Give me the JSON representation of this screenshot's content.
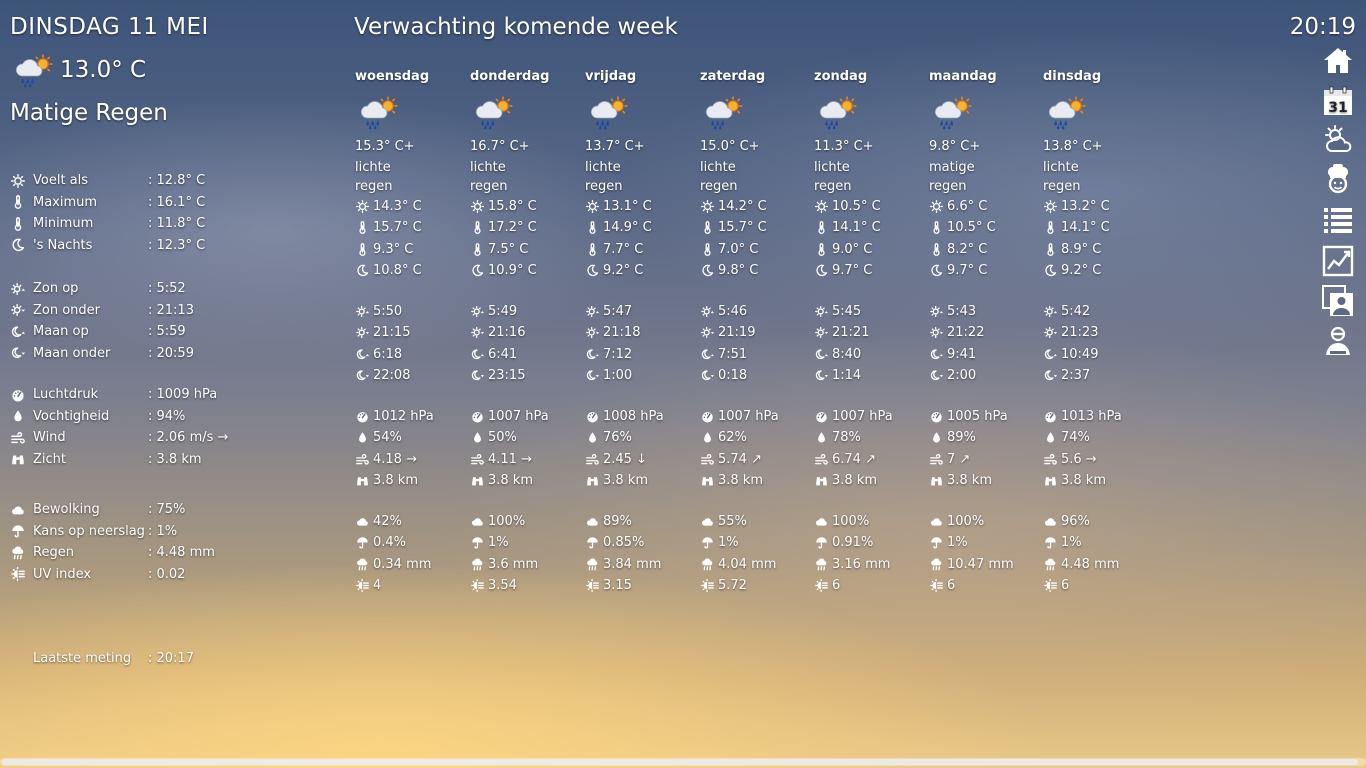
{
  "header": {
    "date": "DINSDAG 11 MEI",
    "clock": "20:19",
    "forecast_title": "Verwachting komende week"
  },
  "current": {
    "temperature": "13.0° C",
    "condition": "Matige Regen",
    "icon": "rain-sun-icon",
    "stats": [
      {
        "icon": "sun-icon",
        "label": "Voelt als",
        "value": ": 12.8° C"
      },
      {
        "icon": "thermometer-icon",
        "label": "Maximum",
        "value": ": 16.1° C"
      },
      {
        "icon": "thermometer-icon",
        "label": "Minimum",
        "value": ": 11.8° C"
      },
      {
        "icon": "moon-icon",
        "label": "'s Nachts",
        "value": ": 12.3° C"
      }
    ],
    "sun_moon": [
      {
        "icon": "sunrise-icon",
        "label": "Zon op",
        "value": ": 5:52"
      },
      {
        "icon": "sunset-icon",
        "label": "Zon onder",
        "value": ": 21:13"
      },
      {
        "icon": "moonrise-icon",
        "label": "Maan op",
        "value": ": 5:59"
      },
      {
        "icon": "moonset-icon",
        "label": "Maan onder",
        "value": ": 20:59"
      }
    ],
    "atmosphere": [
      {
        "icon": "gauge-icon",
        "label": "Luchtdruk",
        "value": ": 1009 hPa"
      },
      {
        "icon": "droplet-icon",
        "label": "Vochtigheid",
        "value": ": 94%"
      },
      {
        "icon": "wind-icon",
        "label": "Wind",
        "value": ": 2.06 m/s →"
      },
      {
        "icon": "binoculars-icon",
        "label": "Zicht",
        "value": ": 3.8 km"
      }
    ],
    "precip": [
      {
        "icon": "cloud-icon",
        "label": "Bewolking",
        "value": ": 75%"
      },
      {
        "icon": "umbrella-icon",
        "label": "Kans op neerslag",
        "value": ": 1%"
      },
      {
        "icon": "rain-icon",
        "label": "Regen",
        "value": ": 4.48 mm"
      },
      {
        "icon": "uv-icon",
        "label": "UV index",
        "value": ": 0.02"
      }
    ],
    "last_measure": {
      "label": "Laatste meting",
      "value": ": 20:17"
    }
  },
  "forecast": [
    {
      "day": "woensdag",
      "temp": "15.3° C+",
      "cond": "lichte regen",
      "feels": "14.3° C",
      "max": "15.7° C",
      "min": "9.3° C",
      "night": "10.8° C",
      "sunrise": "5:50",
      "sunset": "21:15",
      "moonrise": "6:18",
      "moonset": "22:08",
      "pressure": "1012 hPa",
      "humidity": "54%",
      "wind": "4.18 →",
      "visibility": "3.8 km",
      "clouds": "42%",
      "pop": "0.4%",
      "rain": "0.34 mm",
      "uv": "4"
    },
    {
      "day": "donderdag",
      "temp": "16.7° C+",
      "cond": "lichte regen",
      "feels": "15.8° C",
      "max": "17.2° C",
      "min": "7.5° C",
      "night": "10.9° C",
      "sunrise": "5:49",
      "sunset": "21:16",
      "moonrise": "6:41",
      "moonset": "23:15",
      "pressure": "1007 hPa",
      "humidity": "50%",
      "wind": "4.11 →",
      "visibility": "3.8 km",
      "clouds": "100%",
      "pop": "1%",
      "rain": "3.6 mm",
      "uv": "3.54"
    },
    {
      "day": "vrijdag",
      "temp": "13.7° C+",
      "cond": "lichte regen",
      "feels": "13.1° C",
      "max": "14.9° C",
      "min": "7.7° C",
      "night": "9.2° C",
      "sunrise": "5:47",
      "sunset": "21:18",
      "moonrise": "7:12",
      "moonset": "1:00",
      "pressure": "1008 hPa",
      "humidity": "76%",
      "wind": "2.45 ↓",
      "visibility": "3.8 km",
      "clouds": "89%",
      "pop": "0.85%",
      "rain": "3.84 mm",
      "uv": "3.15"
    },
    {
      "day": "zaterdag",
      "temp": "15.0° C+",
      "cond": "lichte regen",
      "feels": "14.2° C",
      "max": "15.7° C",
      "min": "7.0° C",
      "night": "9.8° C",
      "sunrise": "5:46",
      "sunset": "21:19",
      "moonrise": "7:51",
      "moonset": "0:18",
      "pressure": "1007 hPa",
      "humidity": "62%",
      "wind": "5.74 ↗",
      "visibility": "3.8 km",
      "clouds": "55%",
      "pop": "1%",
      "rain": "4.04 mm",
      "uv": "5.72"
    },
    {
      "day": "zondag",
      "temp": "11.3° C+",
      "cond": "lichte regen",
      "feels": "10.5° C",
      "max": "14.1° C",
      "min": "9.0° C",
      "night": "9.7° C",
      "sunrise": "5:45",
      "sunset": "21:21",
      "moonrise": "8:40",
      "moonset": "1:14",
      "pressure": "1007 hPa",
      "humidity": "78%",
      "wind": "6.74 ↗",
      "visibility": "3.8 km",
      "clouds": "100%",
      "pop": "0.91%",
      "rain": "3.16 mm",
      "uv": "6"
    },
    {
      "day": "maandag",
      "temp": "9.8° C+",
      "cond": "matige regen",
      "feels": "6.6° C",
      "max": "10.5° C",
      "min": "8.2° C",
      "night": "9.7° C",
      "sunrise": "5:43",
      "sunset": "21:22",
      "moonrise": "9:41",
      "moonset": "2:00",
      "pressure": "1005 hPa",
      "humidity": "89%",
      "wind": "7 ↗",
      "visibility": "3.8 km",
      "clouds": "100%",
      "pop": "1%",
      "rain": "10.47 mm",
      "uv": "6"
    },
    {
      "day": "dinsdag",
      "temp": "13.8° C+",
      "cond": "lichte regen",
      "feels": "13.2° C",
      "max": "14.1° C",
      "min": "8.9° C",
      "night": "9.2° C",
      "sunrise": "5:42",
      "sunset": "21:23",
      "moonrise": "10:49",
      "moonset": "2:37",
      "pressure": "1013 hPa",
      "humidity": "74%",
      "wind": "5.6 →",
      "visibility": "3.8 km",
      "clouds": "96%",
      "pop": "1%",
      "rain": "4.48 mm",
      "uv": "6"
    }
  ],
  "nav": [
    {
      "name": "home-icon"
    },
    {
      "name": "calendar-icon"
    },
    {
      "name": "weather-icon"
    },
    {
      "name": "chef-icon"
    },
    {
      "name": "list-icon"
    },
    {
      "name": "chart-icon"
    },
    {
      "name": "photos-icon"
    },
    {
      "name": "person-icon"
    }
  ]
}
